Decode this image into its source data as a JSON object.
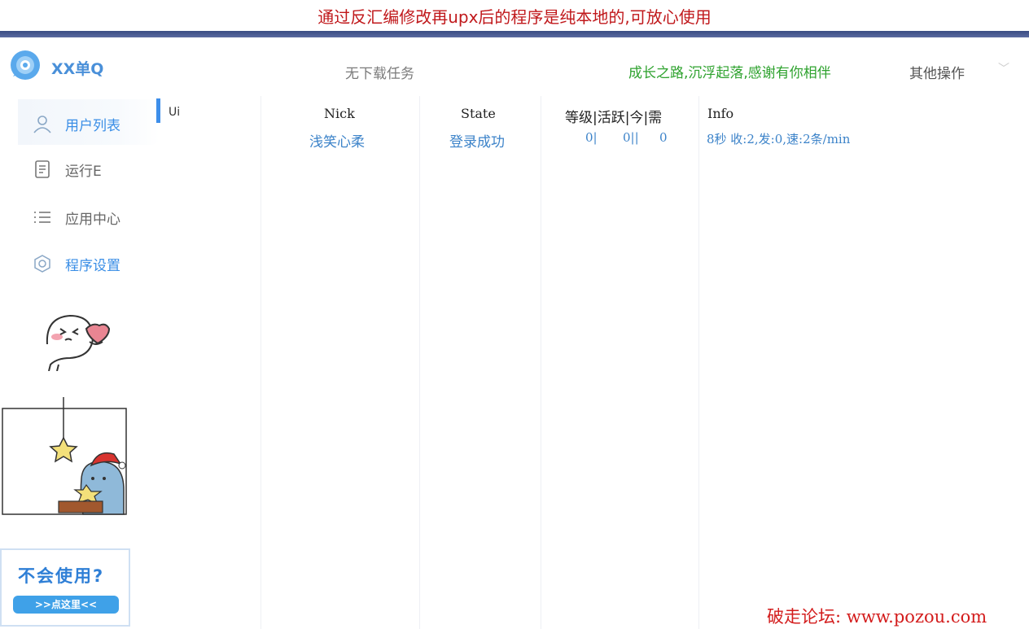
{
  "banner": {
    "text": "通过反汇编修改再upx后的程序是纯本地的,可放心使用"
  },
  "header": {
    "brand": "XX单Q",
    "download_status": "无下载任务",
    "slogan": "成长之路,沉浮起落,感谢有你相伴",
    "more_ops": "其他操作"
  },
  "sidebar": {
    "items": [
      {
        "label": "用户列表",
        "icon": "user-icon"
      },
      {
        "label": "运行E",
        "icon": "log-icon"
      },
      {
        "label": "应用中心",
        "icon": "list-icon"
      },
      {
        "label": "程序设置",
        "icon": "settings-icon"
      }
    ]
  },
  "tab_peek": "Ui",
  "table": {
    "columns": [
      "Nick",
      "State",
      "等级|活跃|今|需",
      "Info"
    ],
    "rows": [
      {
        "nick": "浅笑心柔",
        "state": "登录成功",
        "level": "0|",
        "active": "0||",
        "today": "0",
        "info": "8秒 收:2,发:0,速:2条/min"
      }
    ]
  },
  "help": {
    "title": "不会使用?",
    "button": ">>点这里<<"
  },
  "watermark": "破走论坛: www.pozou.com",
  "colors": {
    "accent": "#3a8ee6",
    "banner_red": "#c0181b",
    "slogan_green": "#2ea22e",
    "watermark_red": "#d31c1c"
  }
}
